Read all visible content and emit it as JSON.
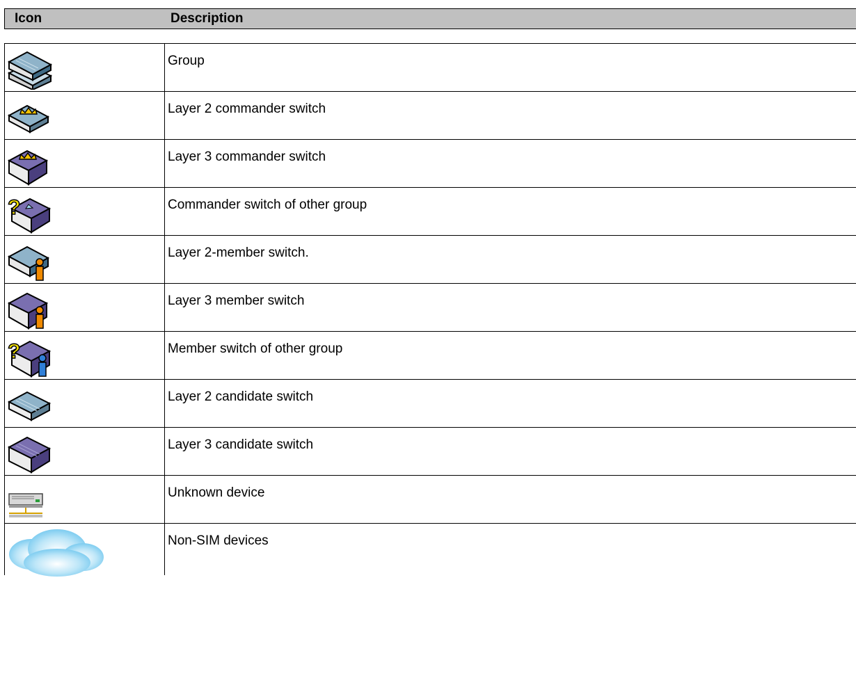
{
  "header": {
    "icon_label": "Icon",
    "description_label": "Description"
  },
  "rows": [
    {
      "icon": "group-icon",
      "description": "Group"
    },
    {
      "icon": "layer2-commander-switch-icon",
      "description": "Layer 2 commander switch"
    },
    {
      "icon": "layer3-commander-switch-icon",
      "description": "Layer 3 commander switch"
    },
    {
      "icon": "commander-switch-other-group-icon",
      "description": "Commander switch of other group"
    },
    {
      "icon": "layer2-member-switch-icon",
      "description": "Layer 2-member switch."
    },
    {
      "icon": "layer3-member-switch-icon",
      "description": "Layer 3 member switch"
    },
    {
      "icon": "member-switch-other-group-icon",
      "description": "Member switch of other group"
    },
    {
      "icon": "layer2-candidate-switch-icon",
      "description": "Layer 2 candidate switch"
    },
    {
      "icon": "layer3-candidate-switch-icon",
      "description": "Layer 3 candidate switch"
    },
    {
      "icon": "unknown-device-icon",
      "description": "Unknown device"
    },
    {
      "icon": "non-sim-devices-cloud-icon",
      "description": "Non-SIM devices"
    }
  ],
  "colors": {
    "header_bg": "#c0c0c0",
    "layer2_top": "#8fb3c9",
    "layer3_top": "#7a6fb0",
    "crown": "#f2c200",
    "question": "#f5e200",
    "member_orange": "#f08a00",
    "member_blue": "#2f7fd8",
    "cloud": "#8fd3f5"
  }
}
